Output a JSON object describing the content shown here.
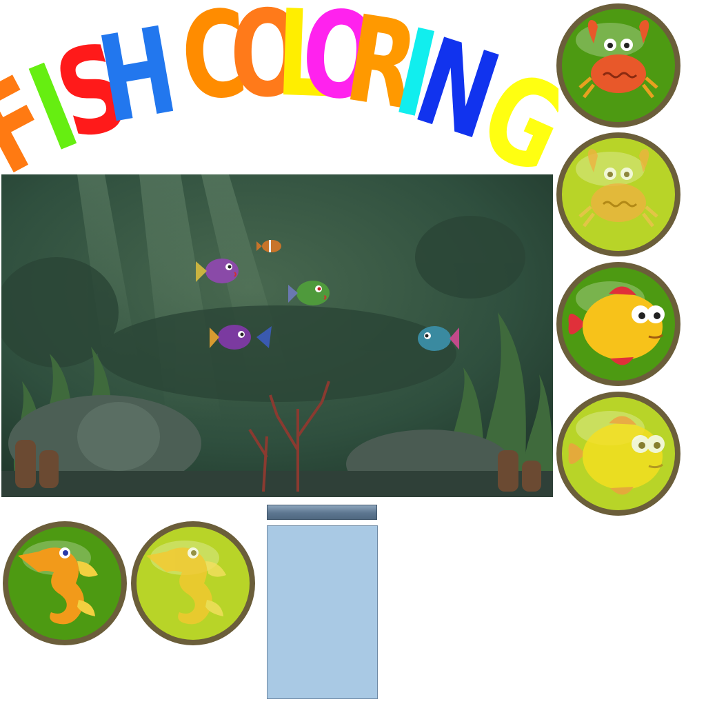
{
  "title": {
    "text": "FISH COLORING",
    "letters": [
      {
        "char": "F",
        "color": "#ff7a12"
      },
      {
        "char": "I",
        "color": "#66ee11"
      },
      {
        "char": "S",
        "color": "#ff1a1a"
      },
      {
        "char": "H",
        "color": "#2277ee"
      },
      {
        "char": "C",
        "color": "#ff8c00"
      },
      {
        "char": "O",
        "color": "#ff7a1a"
      },
      {
        "char": "L",
        "color": "#ffee00"
      },
      {
        "char": "O",
        "color": "#ff22ee"
      },
      {
        "char": "R",
        "color": "#ff9900"
      },
      {
        "char": "I",
        "color": "#11eeee"
      },
      {
        "char": "N",
        "color": "#1133ee"
      },
      {
        "char": "G",
        "color": "#ffff11"
      }
    ]
  },
  "colors": {
    "water": "#2f4f3e",
    "button_green": "#4d9a12",
    "button_lime": "#b8d428",
    "button_rim": "#6b5e3a"
  },
  "buttons": [
    {
      "name": "crab-button",
      "icon": "crab-icon",
      "state": "normal"
    },
    {
      "name": "crab-button-hover",
      "icon": "crab-icon",
      "state": "highlight"
    },
    {
      "name": "goldfish-button",
      "icon": "goldfish-icon",
      "state": "normal"
    },
    {
      "name": "goldfish-button-hover",
      "icon": "goldfish-icon",
      "state": "highlight"
    },
    {
      "name": "seahorse-button",
      "icon": "seahorse-icon",
      "state": "normal"
    },
    {
      "name": "seahorse-button-hover",
      "icon": "seahorse-icon",
      "state": "highlight"
    }
  ]
}
